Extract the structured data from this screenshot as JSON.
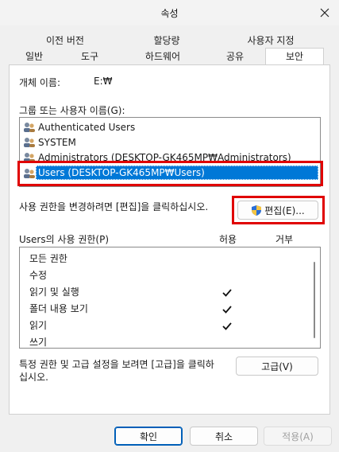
{
  "window": {
    "title": "속성"
  },
  "tabs": {
    "row1": [
      "이전 버전",
      "할당량",
      "사용자 지정"
    ],
    "row2": [
      "일반",
      "도구",
      "하드웨어",
      "공유",
      "보안"
    ],
    "active": "보안"
  },
  "object": {
    "label": "개체 이름:",
    "value": "E:₩"
  },
  "groups": {
    "label": "그룹 또는 사용자 이름(G):",
    "items": [
      "Authenticated Users",
      "SYSTEM",
      "Administrators (DESKTOP-GK465MP₩Administrators)",
      "Users (DESKTOP-GK465MP₩Users)"
    ],
    "selected_index": 3
  },
  "edit": {
    "hint": "사용 권한을 변경하려면 [편집]을 클릭하십시오.",
    "button_label": "편집(E)..."
  },
  "permissions": {
    "label": "Users의 사용 권한(P)",
    "col_allow": "허용",
    "col_deny": "거부",
    "rows": [
      {
        "name": "모든 권한",
        "allow": false,
        "deny": false
      },
      {
        "name": "수정",
        "allow": false,
        "deny": false
      },
      {
        "name": "읽기 및 실행",
        "allow": true,
        "deny": false
      },
      {
        "name": "폴더 내용 보기",
        "allow": true,
        "deny": false
      },
      {
        "name": "읽기",
        "allow": true,
        "deny": false
      },
      {
        "name": "쓰기",
        "allow": false,
        "deny": false
      }
    ]
  },
  "advanced": {
    "hint_line1": "특정 권한 및 고급 설정을 보려면 [고급]을 클릭하",
    "hint_line2": "십시오.",
    "button_label": "고급(V)"
  },
  "footer": {
    "ok": "확인",
    "cancel": "취소",
    "apply": "적용(A)"
  },
  "colors": {
    "selection": "#0078d7",
    "highlight_box": "#e00000",
    "primary_border": "#005fb8"
  }
}
